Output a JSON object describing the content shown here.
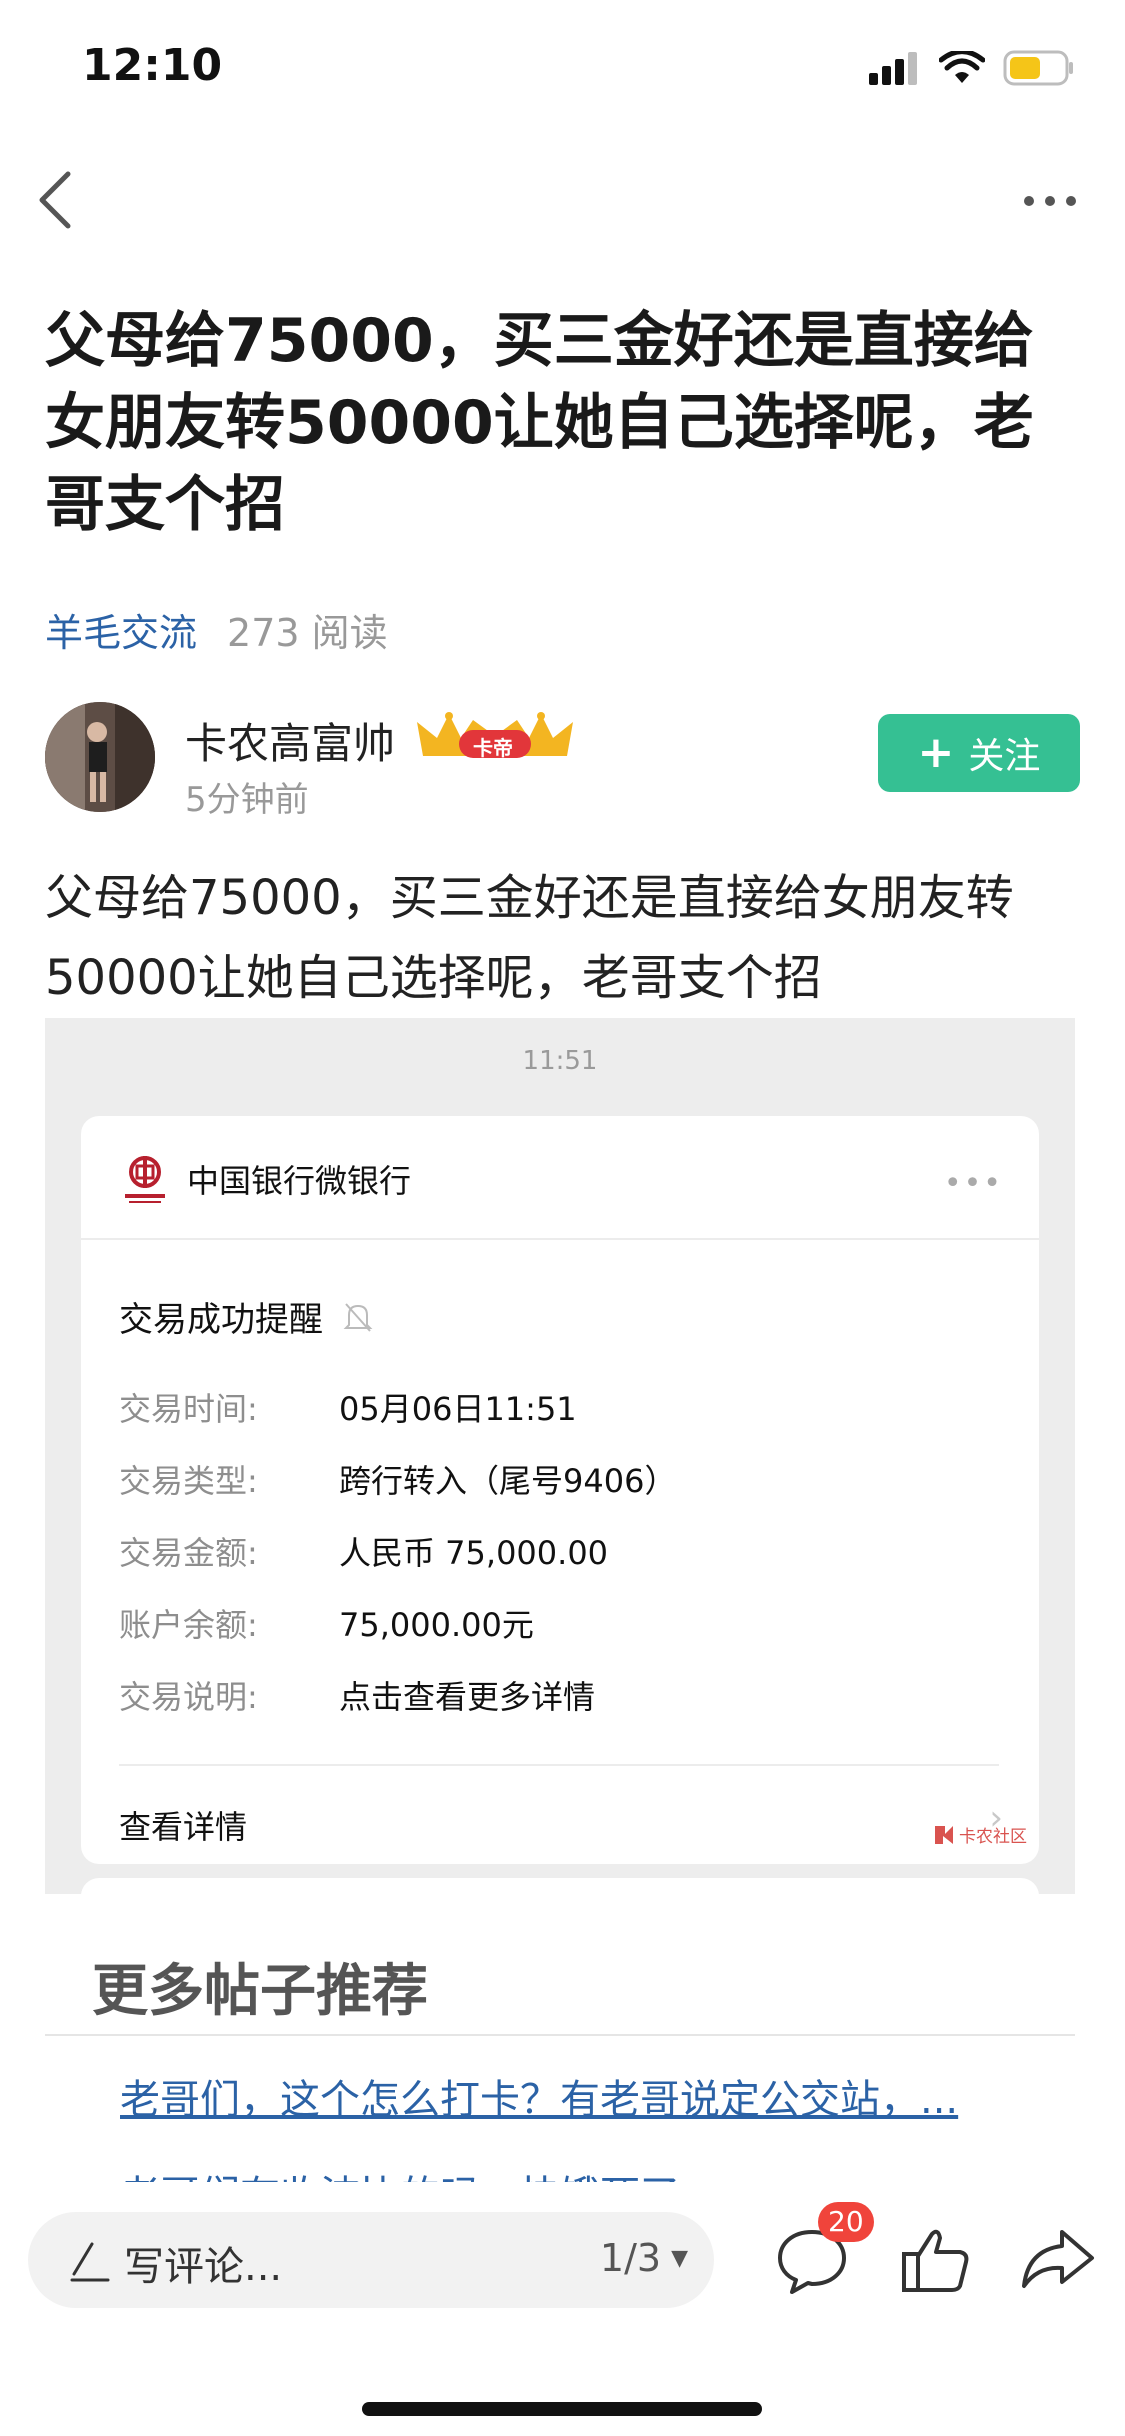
{
  "status_bar": {
    "time": "12:10"
  },
  "post": {
    "title": "父母给75000，买三金好还是直接给女朋友转50000让她自己选择呢，老哥支个招",
    "board": "羊毛交流",
    "reads": "273 阅读",
    "author": {
      "name": "卡农高富帅",
      "badge_label": "卡帝",
      "time": "5分钟前",
      "follow_label": "关注"
    },
    "body": "父母给75000，买三金好还是直接给女朋友转50000让她自己选择呢，老哥支个招"
  },
  "screenshot": {
    "time": "11:51",
    "bank_name": "中国银行微银行",
    "notice_title": "交易成功提醒",
    "rows": [
      {
        "label": "交易时间:",
        "value": "05月06日11:51"
      },
      {
        "label": "交易类型:",
        "value": "跨行转入（尾号9406）"
      },
      {
        "label": "交易金额:",
        "value": "人民币 75,000.00"
      },
      {
        "label": "账户余额:",
        "value": "75,000.00元"
      },
      {
        "label": "交易说明:",
        "value": "点击查看更多详情"
      }
    ],
    "detail_link": "查看详情",
    "watermark": "卡农社区"
  },
  "recommend": {
    "title": "更多帖子推荐",
    "items": [
      "老哥们，这个怎么打卡？有老哥说定公交站，...",
      "老哥们有收波比的吗，快饿死了"
    ]
  },
  "bottom_bar": {
    "comment_placeholder": "写评论...",
    "pager": "1/3",
    "comment_count": "20"
  },
  "colors": {
    "accent": "#35c093",
    "link": "#2b62a6",
    "badge": "#f0443b"
  }
}
